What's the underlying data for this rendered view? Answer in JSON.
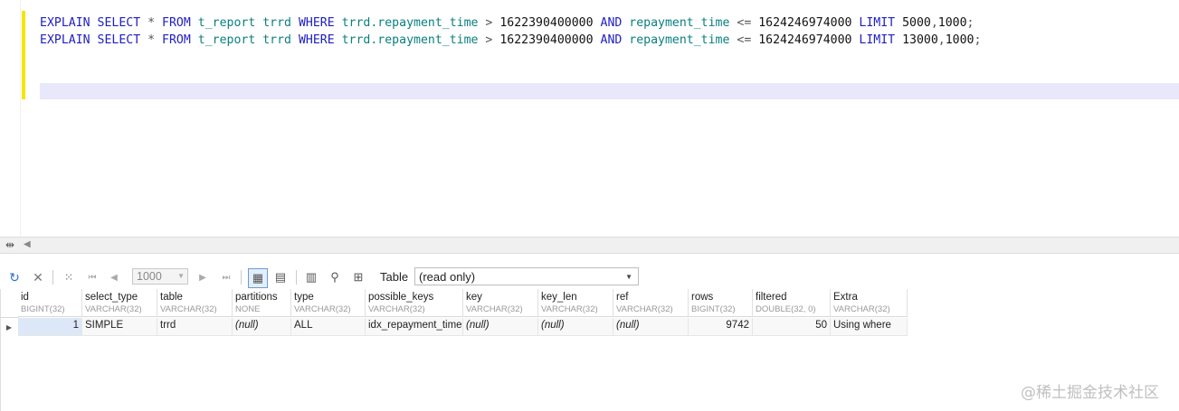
{
  "editor": {
    "lines": [
      {
        "kw1": "EXPLAIN",
        "kw2": "SELECT",
        "star": "*",
        "kw3": "FROM",
        "table": "t_report",
        "alias": "trrd",
        "kw4": "WHERE",
        "col1": "trrd.repayment_time",
        "op1": ">",
        "n1": "1622390400000",
        "kw5": "AND",
        "col2": "repayment_time",
        "op2": "<=",
        "n2": "1624246974000",
        "kw6": "LIMIT",
        "off": "5000",
        "comma": ",",
        "cnt": "1000",
        "semi": ";"
      },
      {
        "kw1": "EXPLAIN",
        "kw2": "SELECT",
        "star": "*",
        "kw3": "FROM",
        "table": "t_report",
        "alias": "trrd",
        "kw4": "WHERE",
        "col1": "trrd.repayment_time",
        "op1": ">",
        "n1": "1622390400000",
        "kw5": "AND",
        "col2": "repayment_time",
        "op2": "<=",
        "n2": "1624246974000",
        "kw6": "LIMIT",
        "off": "13000",
        "comma": ",",
        "cnt": "1000",
        "semi": ";"
      }
    ]
  },
  "toolbar": {
    "icons": [
      "refresh-icon",
      "cancel-icon",
      "grid-options-icon",
      "first-record-icon",
      "previous-page-icon",
      "next-page-icon",
      "last-page-icon",
      "grid-view-icon",
      "form-view-icon",
      "columns-icon",
      "filter-icon",
      "export-icon"
    ],
    "limit_value": "1000",
    "view_label": "Table",
    "view_mode": "(read only)"
  },
  "grid": {
    "columns": [
      {
        "name": "id",
        "type": "BIGINT(32)"
      },
      {
        "name": "select_type",
        "type": "VARCHAR(32)"
      },
      {
        "name": "table",
        "type": "VARCHAR(32)"
      },
      {
        "name": "partitions",
        "type": "NONE"
      },
      {
        "name": "type",
        "type": "VARCHAR(32)"
      },
      {
        "name": "possible_keys",
        "type": "VARCHAR(32)"
      },
      {
        "name": "key",
        "type": "VARCHAR(32)"
      },
      {
        "name": "key_len",
        "type": "VARCHAR(32)"
      },
      {
        "name": "ref",
        "type": "VARCHAR(32)"
      },
      {
        "name": "rows",
        "type": "BIGINT(32)"
      },
      {
        "name": "filtered",
        "type": "DOUBLE(32, 0)"
      },
      {
        "name": "Extra",
        "type": "VARCHAR(32)"
      }
    ],
    "rows": [
      [
        "1",
        "SIMPLE",
        "trrd",
        "(null)",
        "ALL",
        "idx_repayment_time",
        "(null)",
        "(null)",
        "(null)",
        "9742",
        "50",
        "Using where"
      ]
    ]
  },
  "watermark": "@稀土掘金技术社区"
}
